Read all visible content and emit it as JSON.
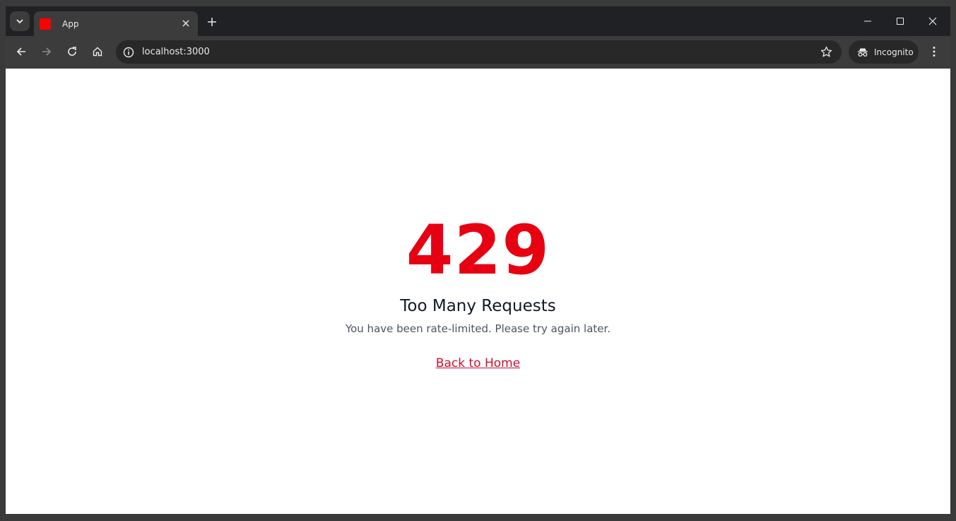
{
  "browser": {
    "tab": {
      "title": "App",
      "favicon_color": "#ff0000"
    },
    "address": {
      "url": "localhost:3000"
    },
    "incognito_label": "Incognito"
  },
  "page": {
    "code": "429",
    "heading": "Too Many Requests",
    "message": "You have been rate-limited. Please try again later.",
    "link_label": "Back to Home",
    "accent_color": "#e60012"
  }
}
